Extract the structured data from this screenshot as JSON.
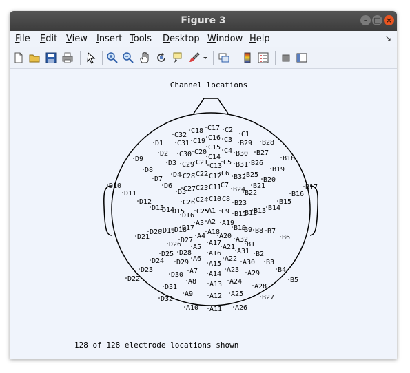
{
  "window": {
    "title": "Figure 3"
  },
  "menu": [
    {
      "label": "File",
      "u": "F",
      "rest": "ile"
    },
    {
      "label": "Edit",
      "u": "E",
      "rest": "dit"
    },
    {
      "label": "View",
      "u": "V",
      "rest": "iew"
    },
    {
      "label": "Insert",
      "u": "I",
      "rest": "nsert"
    },
    {
      "label": "Tools",
      "u": "T",
      "rest": "ools"
    },
    {
      "label": "Desktop",
      "u": "D",
      "rest": "esktop"
    },
    {
      "label": "Window",
      "u": "W",
      "rest": "indow"
    },
    {
      "label": "Help",
      "u": "H",
      "rest": "elp"
    }
  ],
  "toolbar": [
    "new-figure-icon",
    "open-icon",
    "save-icon",
    "print-icon",
    "pointer-icon",
    "zoom-in-icon",
    "zoom-out-icon",
    "pan-icon",
    "rotate-icon",
    "data-cursor-icon",
    "brush-icon",
    "brush-dropdown-icon",
    "link-icon",
    "colorbar-icon",
    "legend-icon",
    "hide-plot-tools-icon",
    "show-plot-tools-icon"
  ],
  "plot": {
    "title": "Channel locations",
    "footer": "128 of 128 electrode locations shown"
  },
  "chart_data": {
    "type": "scatter",
    "title": "Channel locations",
    "electrodes": [
      [
        "C17",
        305,
        186
      ],
      [
        "C18",
        281,
        190
      ],
      [
        "C2",
        330,
        189
      ],
      [
        "C32",
        257,
        196
      ],
      [
        "C1",
        354,
        195
      ],
      [
        "C16",
        306,
        200
      ],
      [
        "C19",
        284,
        205
      ],
      [
        "C3",
        329,
        203
      ],
      [
        "D1",
        229,
        208
      ],
      [
        "C31",
        261,
        208
      ],
      [
        "B29",
        352,
        208
      ],
      [
        "B28",
        384,
        207
      ],
      [
        "C15",
        306,
        214
      ],
      [
        "C20",
        286,
        221
      ],
      [
        "C4",
        329,
        219
      ],
      [
        "D2",
        236,
        223
      ],
      [
        "C30",
        264,
        224
      ],
      [
        "B30",
        346,
        223
      ],
      [
        "B27",
        376,
        222
      ],
      [
        "B18",
        414,
        230
      ],
      [
        "D9",
        200,
        231
      ],
      [
        "C14",
        306,
        228
      ],
      [
        "C21",
        288,
        236
      ],
      [
        "C5",
        328,
        236
      ],
      [
        "D3",
        248,
        237
      ],
      [
        "C29",
        268,
        239
      ],
      [
        "B31",
        346,
        239
      ],
      [
        "B26",
        368,
        237
      ],
      [
        "C13",
        308,
        241
      ],
      [
        "D8",
        214,
        247
      ],
      [
        "C6",
        325,
        252
      ],
      [
        "D4",
        255,
        254
      ],
      [
        "C28",
        269,
        256
      ],
      [
        "C22",
        288,
        253
      ],
      [
        "C12",
        307,
        256
      ],
      [
        "B32",
        343,
        257
      ],
      [
        "B25",
        361,
        254
      ],
      [
        "B19",
        399,
        246
      ],
      [
        "D7",
        228,
        260
      ],
      [
        "B20",
        386,
        261
      ],
      [
        "D6",
        242,
        270
      ],
      [
        "C27",
        270,
        274
      ],
      [
        "C23",
        288,
        273
      ],
      [
        "C11",
        307,
        272
      ],
      [
        "C7",
        324,
        269
      ],
      [
        "B24",
        342,
        275
      ],
      [
        "B21",
        371,
        270
      ],
      [
        "D10",
        162,
        270
      ],
      [
        "B17",
        447,
        272
      ],
      [
        "D11",
        184,
        281
      ],
      [
        "D5",
        262,
        279
      ],
      [
        "B22",
        359,
        280
      ],
      [
        "B16",
        427,
        282
      ],
      [
        "D12",
        206,
        293
      ],
      [
        "C26",
        269,
        294
      ],
      [
        "C24",
        288,
        290
      ],
      [
        "C10",
        307,
        289
      ],
      [
        "C8",
        326,
        289
      ],
      [
        "B23",
        344,
        295
      ],
      [
        "B15",
        409,
        293
      ],
      [
        "D13",
        224,
        302
      ],
      [
        "D14",
        239,
        305
      ],
      [
        "D15",
        254,
        307
      ],
      [
        "C25",
        289,
        307
      ],
      [
        "A1",
        305,
        306
      ],
      [
        "C9",
        325,
        307
      ],
      [
        "B11",
        344,
        311
      ],
      [
        "B13",
        372,
        306
      ],
      [
        "B14",
        393,
        302
      ],
      [
        "B12",
        359,
        309
      ],
      [
        "D16",
        268,
        313
      ],
      [
        "A3",
        288,
        324
      ],
      [
        "A2",
        305,
        322
      ],
      [
        "A19",
        326,
        324
      ],
      [
        "D17",
        268,
        331
      ],
      [
        "D19",
        240,
        335
      ],
      [
        "D18",
        257,
        334
      ],
      [
        "B10",
        343,
        331
      ],
      [
        "B9",
        358,
        334
      ],
      [
        "B8",
        374,
        335
      ],
      [
        "B7",
        392,
        336
      ],
      [
        "D20",
        221,
        337
      ],
      [
        "A18",
        305,
        337
      ],
      [
        "A4",
        290,
        343
      ],
      [
        "A20",
        322,
        343
      ],
      [
        "D27",
        266,
        349
      ],
      [
        "A32",
        346,
        348
      ],
      [
        "D21",
        203,
        344
      ],
      [
        "B6",
        413,
        345
      ],
      [
        "D26",
        249,
        355
      ],
      [
        "A17",
        307,
        353
      ],
      [
        "A5",
        284,
        359
      ],
      [
        "A21",
        327,
        359
      ],
      [
        "B1",
        362,
        355
      ],
      [
        "D25",
        238,
        369
      ],
      [
        "D28",
        264,
        367
      ],
      [
        "A16",
        307,
        368
      ],
      [
        "A31",
        348,
        365
      ],
      [
        "B2",
        375,
        369
      ],
      [
        "A6",
        284,
        376
      ],
      [
        "A22",
        330,
        376
      ],
      [
        "D24",
        224,
        379
      ],
      [
        "D29",
        260,
        381
      ],
      [
        "A15",
        307,
        383
      ],
      [
        "A30",
        356,
        381
      ],
      [
        "B3",
        390,
        381
      ],
      [
        "D23",
        208,
        392
      ],
      [
        "A7",
        279,
        394
      ],
      [
        "A23",
        333,
        392
      ],
      [
        "A14",
        307,
        398
      ],
      [
        "A29",
        363,
        397
      ],
      [
        "B4",
        407,
        392
      ],
      [
        "D30",
        252,
        399
      ],
      [
        "D22",
        189,
        405
      ],
      [
        "B5",
        425,
        407
      ],
      [
        "A8",
        277,
        409
      ],
      [
        "A24",
        337,
        409
      ],
      [
        "A13",
        308,
        413
      ],
      [
        "D31",
        243,
        417
      ],
      [
        "A28",
        373,
        416
      ],
      [
        "A9",
        272,
        427
      ],
      [
        "A25",
        339,
        427
      ],
      [
        "A12",
        308,
        430
      ],
      [
        "D32",
        237,
        434
      ],
      [
        "B27",
        384,
        432
      ],
      [
        "A10",
        274,
        447
      ],
      [
        "A11",
        308,
        449
      ],
      [
        "A26",
        345,
        447
      ]
    ]
  }
}
